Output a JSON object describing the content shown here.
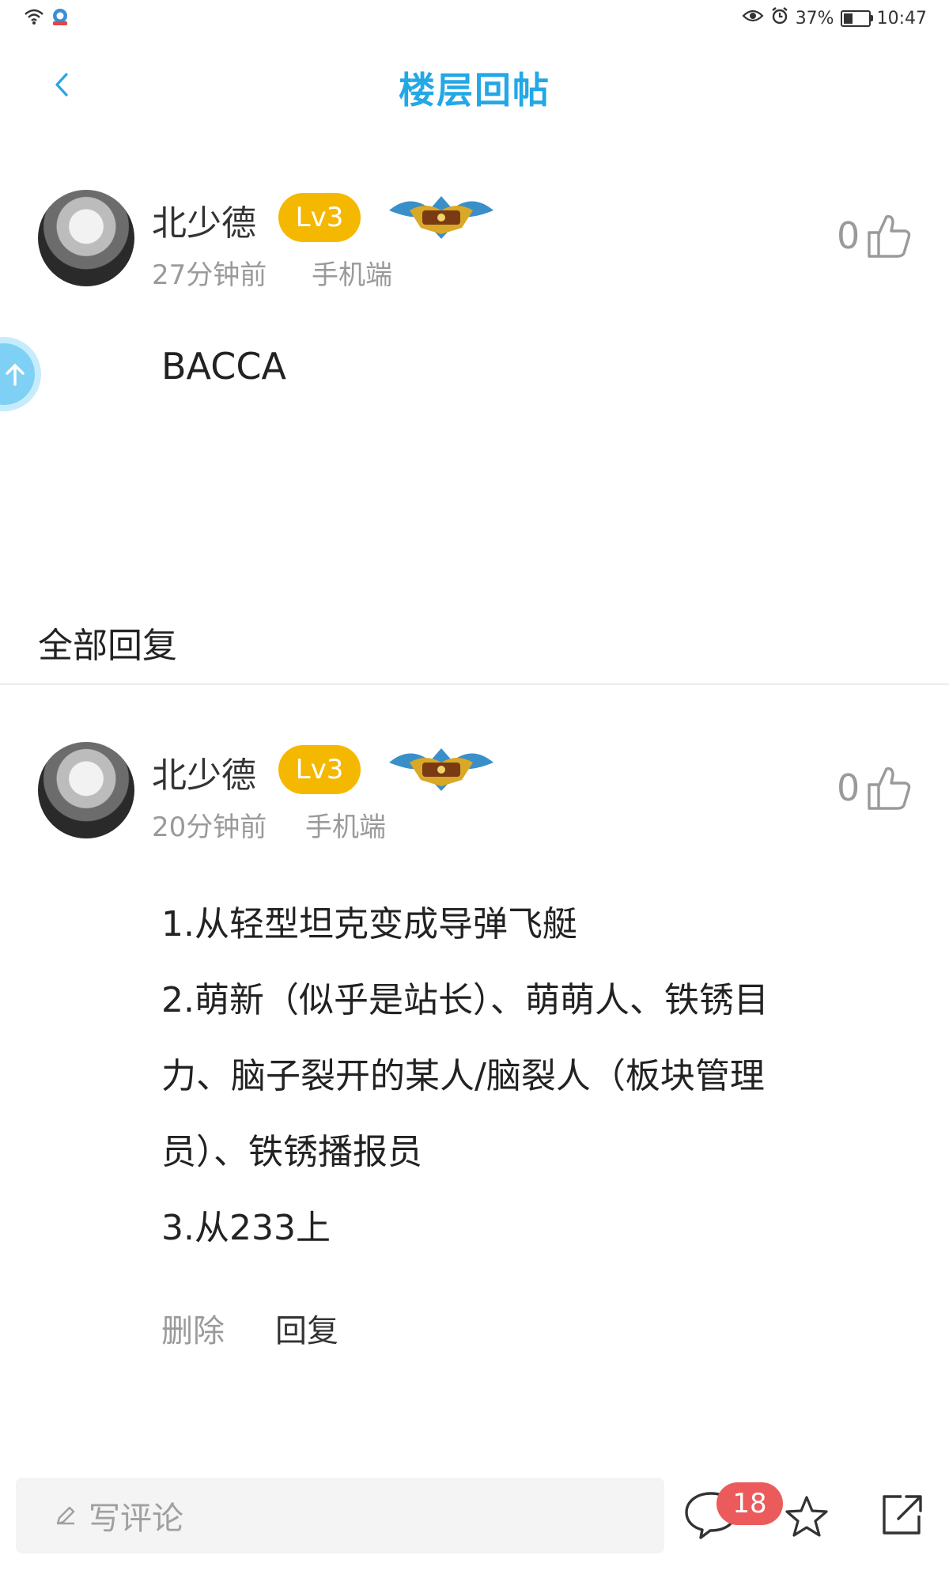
{
  "status_bar": {
    "battery_percent": "37%",
    "battery_level": 0.37,
    "time": "10:47"
  },
  "header": {
    "title": "楼层回帖",
    "back_icon": "chevron-left-icon"
  },
  "post": {
    "username": "北少德",
    "level": "Lv3",
    "time": "27分钟前",
    "device": "手机端",
    "likes": "0",
    "content": "BACCA"
  },
  "replies_section": {
    "title": "全部回复"
  },
  "reply": {
    "username": "北少德",
    "level": "Lv3",
    "time": "20分钟前",
    "device": "手机端",
    "likes": "0",
    "lines": [
      "1.从轻型坦克变成导弹飞艇",
      "2.萌新（似乎是站长）、萌萌人、铁锈目",
      "力、脑子裂开的某人/脑裂人（板块管理",
      "员）、铁锈播报员",
      "3.从233上"
    ],
    "delete_label": "删除",
    "reply_label": "回复"
  },
  "bottom_bar": {
    "comment_placeholder": "写评论",
    "comment_count": "18",
    "icons": [
      "pencil-icon",
      "comment-bubble-icon",
      "star-icon",
      "share-icon"
    ]
  },
  "colors": {
    "accent": "#23a8e6",
    "level_badge": "#f5b800",
    "count_badge": "#ec5b5b"
  }
}
